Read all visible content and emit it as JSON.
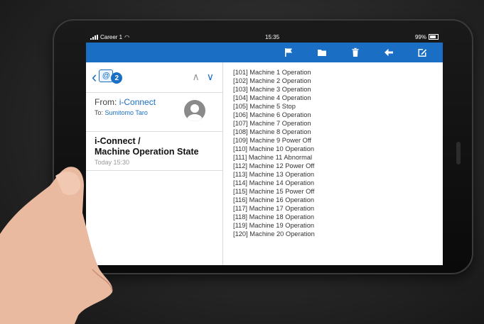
{
  "status_bar": {
    "carrier": "Career 1",
    "time": "15:35",
    "battery": "99%"
  },
  "toolbar": {
    "buttons": [
      {
        "icon": "flag-icon"
      },
      {
        "icon": "folder-icon"
      },
      {
        "icon": "trash-icon"
      },
      {
        "icon": "reply-arrow-icon"
      },
      {
        "icon": "compose-icon"
      }
    ]
  },
  "mail": {
    "badge_count": "2",
    "from_label": "From:",
    "from_sender": "i-Connect",
    "to_label": "To:",
    "to_recipient": "Sumitomo Taro",
    "subject": "i-Connect  /\nMachine Operation State",
    "date": "Today 15:30"
  },
  "messages": [
    "[101] Machine 1 Operation",
    "[102] Machine 2 Operation",
    "[103] Machine 3 Operation",
    "[104] Machine 4 Operation",
    "[105] Machine 5 Stop",
    "[106] Machine 6 Operation",
    "[107] Machine 7 Operation",
    "[108] Machine 8 Operation",
    "[109] Machine 9 Power Off",
    "[110] Machine 10 Operation",
    "[111] Machine 11 Abnormal",
    "[112] Machine 12 Power Off",
    "[113] Machine 13 Operation",
    "[114] Machine 14 Operation",
    "[115] Machine 15 Power Off",
    "[116] Machine 16 Operation",
    "[117] Machine 17 Operation",
    "[118] Machine 18 Operation",
    "[119] Machine 19 Operation",
    "[120] Machine 20 Operation"
  ],
  "colors": {
    "accent": "#1a6fc4",
    "status_bar": "#1a1a1a",
    "background": "#2a2a2a"
  }
}
